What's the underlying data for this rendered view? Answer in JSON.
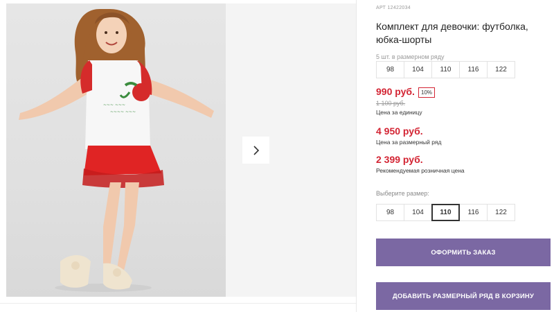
{
  "product": {
    "sku": "АРТ 12422034",
    "title": "Комплект для девочки: футболка, юбка-шорты"
  },
  "pack": {
    "label": "5 шт. в размерном ряду",
    "sizes": [
      "98",
      "104",
      "110",
      "116",
      "122"
    ]
  },
  "pricing": {
    "unit_price": "990 руб.",
    "discount_badge": "10%",
    "old_price": "1 100 руб.",
    "unit_caption": "Цена за единицу",
    "pack_price": "4 950 руб.",
    "pack_caption": "Цена за размерный ряд",
    "retail_price": "2 399 руб.",
    "retail_caption": "Рекомендуемая розничная цена",
    "accent_color": "#d32433"
  },
  "size_select": {
    "label": "Выберите размер:",
    "options": [
      "98",
      "104",
      "110",
      "116",
      "122"
    ],
    "selected": "110"
  },
  "actions": {
    "order_label": "ОФОРМИТЬ ЗАКАЗ",
    "add_pack_label": "ДОБАВИТЬ РАЗМЕРНЫЙ РЯД В КОРЗИНУ",
    "button_color": "#7b68a3"
  },
  "gallery": {
    "next_icon": "chevron-right-icon"
  }
}
